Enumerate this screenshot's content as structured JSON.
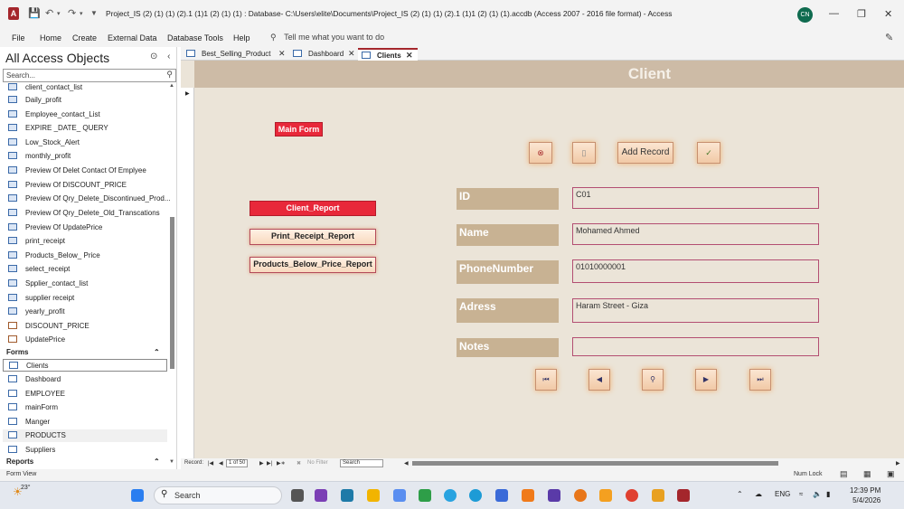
{
  "window": {
    "title": "Project_IS (2) (1) (1) (2).1 (1)1 (2) (1) (1) : Database- C:\\Users\\elite\\Documents\\Project_IS (2) (1) (1) (2).1 (1)1 (2) (1) (1).accdb (Access 2007 - 2016 file format)  -  Access",
    "app_icon": "A",
    "avatar": "CN",
    "minimize": "—",
    "restore": "❐",
    "close": "✕"
  },
  "ribbon": {
    "tabs": [
      "File",
      "Home",
      "Create",
      "External Data",
      "Database Tools",
      "Help"
    ],
    "tell_me": "Tell me what you want to do"
  },
  "nav": {
    "title": "All Access Objects",
    "search_placeholder": "Search...",
    "query_items": [
      "client_contact_list",
      "Daily_profit",
      "Employee_contact_List",
      "EXPIRE _DATE_ QUERY",
      "Low_Stock_Alert",
      "monthly_profit",
      "Preview Of Delet Contact Of Emplyee",
      "Preview Of DISCOUNT_PRICE",
      "Preview Of Qry_Delete_Discontinued_Prod...",
      "Preview Of Qry_Delete_Old_Transcations",
      "Preview Of UpdatePrice",
      "print_receipt",
      "Products_Below_ Price",
      "select_receipt",
      "Spplier_contact_list",
      "supplier receipt",
      "yearly_profit"
    ],
    "macro_items": [
      "DISCOUNT_PRICE",
      "UpdatePrice"
    ],
    "forms_group": "Forms",
    "form_items": [
      "Clients",
      "Dashboard",
      "EMPLOYEE",
      "mainForm",
      "Manger",
      "PRODUCTS",
      "Suppliers"
    ],
    "reports_group": "Reports"
  },
  "doc_tabs": [
    "Best_Selling_Product",
    "Dashboard",
    "Clients"
  ],
  "form": {
    "title": "Client",
    "main_form_btn": "Main Form",
    "client_report_btn": "Client_Report",
    "print_receipt_btn": "Print_Receipt_Report",
    "products_below_btn": "Products_Below_Price_Report",
    "add_record_btn": "Add Record",
    "fields": [
      {
        "label": "ID",
        "value": "C01"
      },
      {
        "label": "Name",
        "value": "Mohamed Ahmed"
      },
      {
        "label": "PhoneNumber",
        "value": "01010000001"
      },
      {
        "label": "Adress",
        "value": "Haram Street - Giza"
      },
      {
        "label": "Notes",
        "value": ""
      }
    ]
  },
  "record_nav": {
    "label": "Record:",
    "position": "1 of 50",
    "filter": "No Filter",
    "search": "Search"
  },
  "status": {
    "left": "Form View",
    "num_lock": "Num Lock"
  },
  "taskbar": {
    "weather": "23°",
    "search": "Search",
    "lang": "ENG",
    "time": "12:39 PM",
    "date": "5/4/2026"
  },
  "colors": {
    "header": "#cdbba6",
    "form_bg": "#ebe4d8",
    "label_bg": "#c8b293",
    "red_button": "#e8283a",
    "field_border": "#b34e72"
  }
}
